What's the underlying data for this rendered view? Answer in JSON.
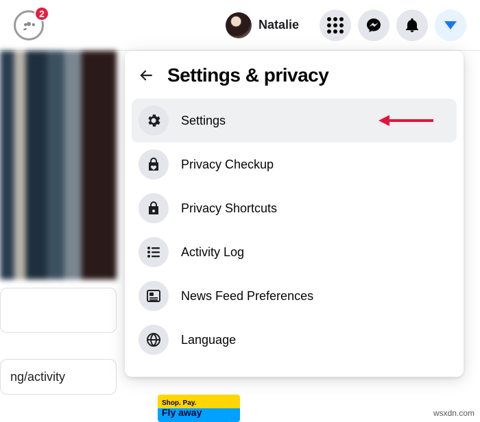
{
  "topbar": {
    "groups_notif_count": "2",
    "user_name": "Natalie"
  },
  "panel": {
    "title": "Settings & privacy",
    "items": [
      {
        "label": "Settings"
      },
      {
        "label": "Privacy Checkup"
      },
      {
        "label": "Privacy Shortcuts"
      },
      {
        "label": "Activity Log"
      },
      {
        "label": "News Feed Preferences"
      },
      {
        "label": "Language"
      }
    ]
  },
  "sidebar": {
    "activity_card_text": "ng/activity"
  },
  "ad": {
    "line1": "Shop. Pay.",
    "line2": "Fly away"
  },
  "attribution": "wsxdn.com"
}
